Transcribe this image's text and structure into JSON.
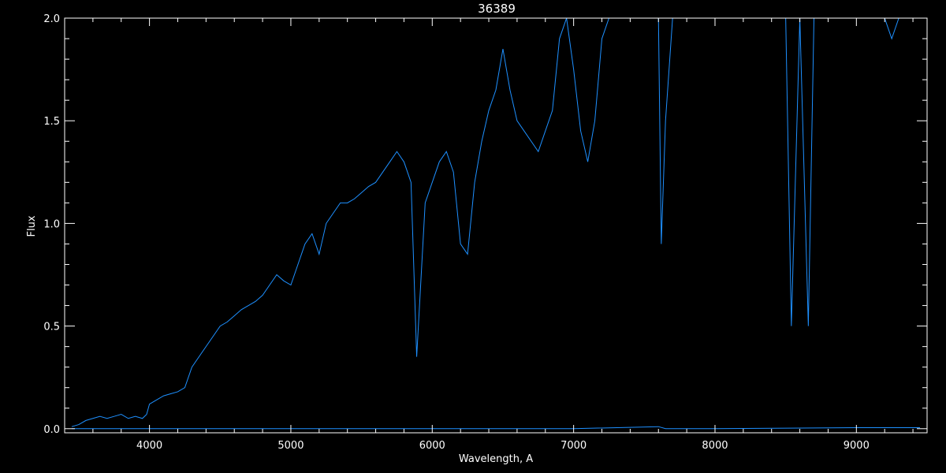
{
  "chart_data": {
    "type": "line",
    "title": "36389",
    "xlabel": "Wavelength, A",
    "ylabel": "Flux",
    "xlim": [
      3400,
      9500
    ],
    "ylim": [
      -0.02,
      2.0
    ],
    "x_ticks": [
      4000,
      5000,
      6000,
      7000,
      8000,
      9000
    ],
    "x_tick_labels": [
      "4000",
      "5000",
      "6000",
      "7000",
      "8000",
      "9000"
    ],
    "y_ticks": [
      0.0,
      0.5,
      1.0,
      1.5,
      2.0
    ],
    "y_tick_labels": [
      "0.0",
      "0.5",
      "1.0",
      "1.5",
      "2.0"
    ],
    "grid": false,
    "colors": {
      "background": "#000000",
      "axes": "#ffffff",
      "series": "#1e90ff"
    },
    "series": [
      {
        "name": "",
        "x": [
          3450,
          3500,
          3550,
          3600,
          3650,
          3700,
          3750,
          3800,
          3850,
          3900,
          3950,
          3980,
          4000,
          4050,
          4100,
          4150,
          4200,
          4250,
          4300,
          4350,
          4400,
          4450,
          4500,
          4550,
          4600,
          4650,
          4700,
          4750,
          4800,
          4850,
          4900,
          4950,
          5000,
          5050,
          5100,
          5150,
          5200,
          5250,
          5300,
          5350,
          5400,
          5450,
          5500,
          5550,
          5600,
          5650,
          5700,
          5750,
          5800,
          5850,
          5890,
          5950,
          6000,
          6050,
          6100,
          6150,
          6200,
          6250,
          6300,
          6350,
          6400,
          6450,
          6500,
          6550,
          6600,
          6650,
          6700,
          6750,
          6800,
          6850,
          6900,
          6950,
          7000,
          7050,
          7100,
          7150,
          7200,
          7250,
          7300,
          7400,
          7500,
          7600,
          7620,
          7650,
          7700,
          7800,
          7900,
          8000,
          8100,
          8200,
          8300,
          8400,
          8500,
          8540,
          8600,
          8660,
          8700,
          8800,
          8900,
          9000,
          9100,
          9200,
          9250,
          9300,
          9400,
          9450
        ],
        "y": [
          0.01,
          0.02,
          0.04,
          0.05,
          0.06,
          0.05,
          0.06,
          0.07,
          0.05,
          0.06,
          0.05,
          0.07,
          0.12,
          0.14,
          0.16,
          0.17,
          0.18,
          0.2,
          0.3,
          0.35,
          0.4,
          0.45,
          0.5,
          0.52,
          0.55,
          0.58,
          0.6,
          0.62,
          0.65,
          0.7,
          0.75,
          0.72,
          0.7,
          0.8,
          0.9,
          0.95,
          0.85,
          1.0,
          1.05,
          1.1,
          1.1,
          1.12,
          1.15,
          1.18,
          1.2,
          1.25,
          1.3,
          1.35,
          1.3,
          1.2,
          0.35,
          1.1,
          1.2,
          1.3,
          1.35,
          1.25,
          0.9,
          0.85,
          1.2,
          1.4,
          1.55,
          1.65,
          1.85,
          1.65,
          1.5,
          1.45,
          1.4,
          1.35,
          1.45,
          1.55,
          1.9,
          2.0,
          1.75,
          1.45,
          1.3,
          1.5,
          1.9,
          2.0,
          2.0,
          2.0,
          2.0,
          2.0,
          0.9,
          1.5,
          2.0,
          2.0,
          2.0,
          2.0,
          2.0,
          2.0,
          2.0,
          2.0,
          2.0,
          0.5,
          2.0,
          0.5,
          2.0,
          2.0,
          2.0,
          2.0,
          2.0,
          2.0,
          1.9,
          2.0,
          2.0,
          2.0
        ]
      },
      {
        "name": "",
        "x": [
          3450,
          4000,
          5000,
          6000,
          7000,
          7600,
          7650,
          8000,
          9000,
          9450
        ],
        "y": [
          0.0,
          0.0,
          0.0,
          0.0,
          0.0,
          0.01,
          0.0,
          0.0,
          0.005,
          0.005
        ]
      }
    ]
  }
}
